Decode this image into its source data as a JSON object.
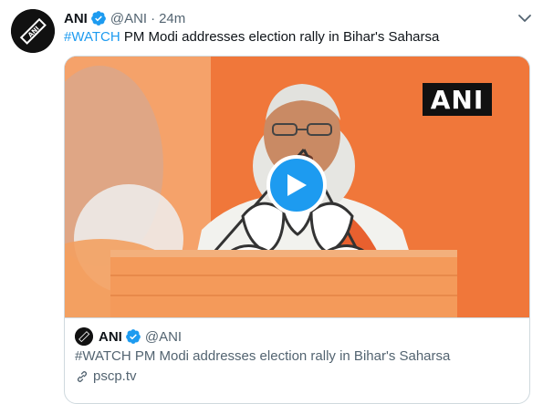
{
  "tweet": {
    "display_name": "ANI",
    "handle": "@ANI",
    "separator": "·",
    "time": "24m",
    "hashtag": "#WATCH",
    "text": " PM Modi addresses election rally in Bihar's Saharsa"
  },
  "media": {
    "watermark": "ANI"
  },
  "quoted": {
    "display_name": "ANI",
    "handle": "@ANI",
    "text": "#WATCH PM Modi addresses election rally in Bihar's Saharsa",
    "link": "pscp.tv"
  },
  "colors": {
    "accent": "#1d9bf0",
    "stage_orange": "#f0773a",
    "secondary_text": "#536471"
  },
  "icons": [
    "avatar-ani-logo",
    "verified-badge-icon",
    "chevron-down-icon",
    "play-icon",
    "link-icon"
  ]
}
